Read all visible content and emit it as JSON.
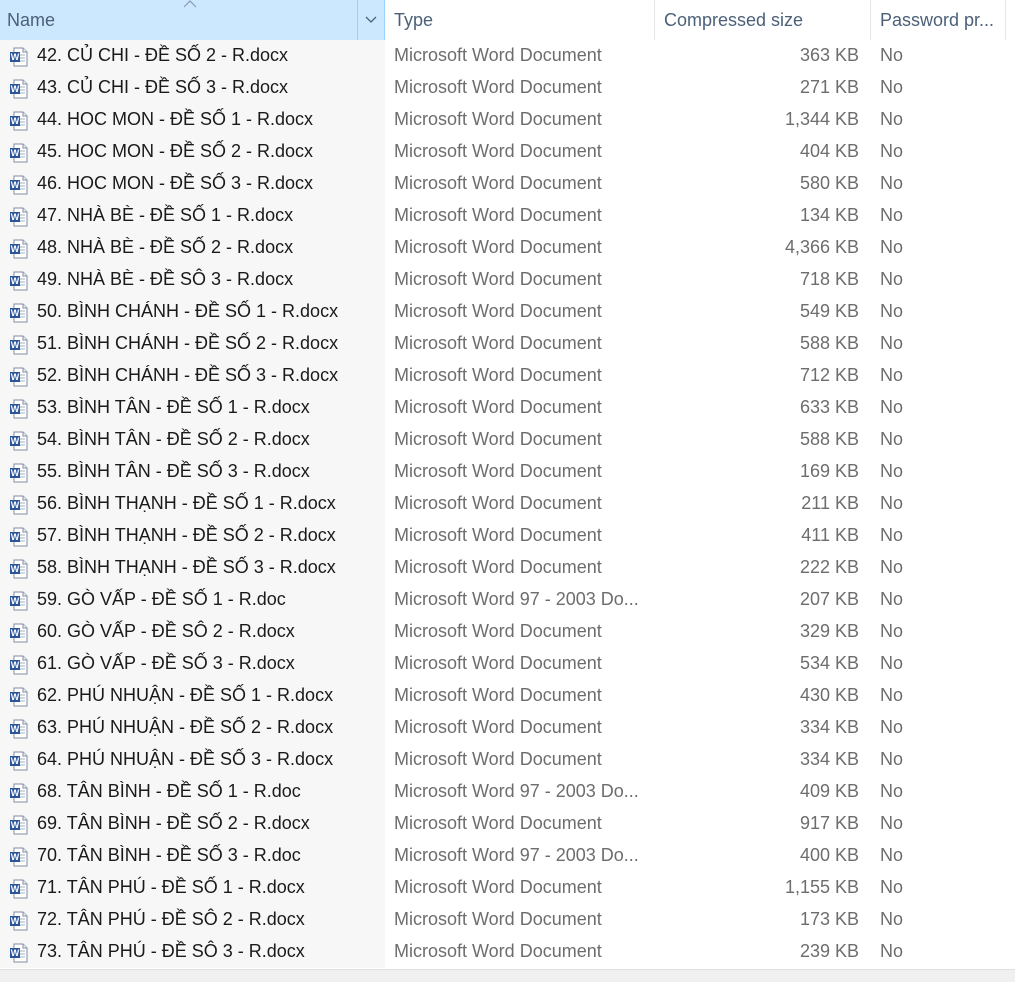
{
  "header": {
    "name_label": "Name",
    "type_label": "Type",
    "size_label": "Compressed size",
    "password_label": "Password pr..."
  },
  "colors": {
    "selected_header_bg": "#cce8ff",
    "header_text": "#4c607a",
    "word_icon_blue": "#2b579a"
  },
  "icons": {
    "file": "word-document-icon",
    "sort": "sort-up-arrow-icon",
    "dropdown": "chevron-down-icon"
  },
  "rows": [
    {
      "name": "42. CỦ CHI - ĐỀ SỐ 2 - R.docx",
      "type": "Microsoft Word Document",
      "size": "363 KB",
      "password": "No"
    },
    {
      "name": "43. CỦ CHI - ĐỀ SỐ 3 - R.docx",
      "type": "Microsoft Word Document",
      "size": "271 KB",
      "password": "No"
    },
    {
      "name": "44. HOC MON - ĐỀ SỐ 1 - R.docx",
      "type": "Microsoft Word Document",
      "size": "1,344 KB",
      "password": "No"
    },
    {
      "name": "45. HOC MON - ĐỀ SỐ 2 - R.docx",
      "type": "Microsoft Word Document",
      "size": "404 KB",
      "password": "No"
    },
    {
      "name": "46. HOC MON - ĐỀ SỐ 3 - R.docx",
      "type": "Microsoft Word Document",
      "size": "580 KB",
      "password": "No"
    },
    {
      "name": "47. NHÀ BÈ - ĐỀ SỐ 1 - R.docx",
      "type": "Microsoft Word Document",
      "size": "134 KB",
      "password": "No"
    },
    {
      "name": "48. NHÀ BÈ - ĐỀ SỐ 2 - R.docx",
      "type": "Microsoft Word Document",
      "size": "4,366 KB",
      "password": "No"
    },
    {
      "name": "49. NHÀ BÈ - ĐỀ SÔ 3 - R.docx",
      "type": "Microsoft Word Document",
      "size": "718 KB",
      "password": "No"
    },
    {
      "name": "50. BÌNH CHÁNH - ĐỀ SỐ 1 - R.docx",
      "type": "Microsoft Word Document",
      "size": "549 KB",
      "password": "No"
    },
    {
      "name": "51. BÌNH CHÁNH - ĐỀ SỐ 2 - R.docx",
      "type": "Microsoft Word Document",
      "size": "588 KB",
      "password": "No"
    },
    {
      "name": "52. BÌNH CHÁNH - ĐỀ SỐ 3 - R.docx",
      "type": "Microsoft Word Document",
      "size": "712 KB",
      "password": "No"
    },
    {
      "name": "53. BÌNH TÂN - ĐỀ SỐ 1 - R.docx",
      "type": "Microsoft Word Document",
      "size": "633 KB",
      "password": "No"
    },
    {
      "name": "54. BÌNH TÂN - ĐỀ SỐ 2 - R.docx",
      "type": "Microsoft Word Document",
      "size": "588 KB",
      "password": "No"
    },
    {
      "name": "55. BÌNH TÂN - ĐỀ SỐ 3 - R.docx",
      "type": "Microsoft Word Document",
      "size": "169 KB",
      "password": "No"
    },
    {
      "name": "56. BÌNH THẠNH - ĐỀ SỐ 1 - R.docx",
      "type": "Microsoft Word Document",
      "size": "211 KB",
      "password": "No"
    },
    {
      "name": "57. BÌNH THẠNH - ĐỀ SỐ 2 - R.docx",
      "type": "Microsoft Word Document",
      "size": "411 KB",
      "password": "No"
    },
    {
      "name": "58. BÌNH THẠNH - ĐỀ SỐ 3 - R.docx",
      "type": "Microsoft Word Document",
      "size": "222 KB",
      "password": "No"
    },
    {
      "name": "59. GÒ VẤP - ĐỀ SỐ 1 - R.doc",
      "type": "Microsoft Word 97 - 2003 Do...",
      "size": "207 KB",
      "password": "No"
    },
    {
      "name": "60. GÒ VẤP - ĐỀ SÔ 2 - R.docx",
      "type": "Microsoft Word Document",
      "size": "329 KB",
      "password": "No"
    },
    {
      "name": "61. GÒ VẤP - ĐỀ SỐ 3 - R.docx",
      "type": "Microsoft Word Document",
      "size": "534 KB",
      "password": "No"
    },
    {
      "name": "62. PHÚ NHUẬN - ĐỀ SỐ 1 - R.docx",
      "type": "Microsoft Word Document",
      "size": "430 KB",
      "password": "No"
    },
    {
      "name": "63. PHÚ NHUẬN - ĐỀ SỐ 2 - R.docx",
      "type": "Microsoft Word Document",
      "size": "334 KB",
      "password": "No"
    },
    {
      "name": "64. PHÚ NHUẬN - ĐỀ SỐ 3 - R.docx",
      "type": "Microsoft Word Document",
      "size": "334 KB",
      "password": "No"
    },
    {
      "name": "68. TÂN BÌNH - ĐỀ SỐ 1 - R.doc",
      "type": "Microsoft Word 97 - 2003 Do...",
      "size": "409 KB",
      "password": "No"
    },
    {
      "name": "69. TÂN BÌNH - ĐỀ SỐ 2 - R.docx",
      "type": "Microsoft Word Document",
      "size": "917 KB",
      "password": "No"
    },
    {
      "name": "70. TÂN BÌNH - ĐỀ SỐ 3 - R.doc",
      "type": "Microsoft Word 97 - 2003 Do...",
      "size": "400 KB",
      "password": "No"
    },
    {
      "name": "71. TÂN PHÚ - ĐỀ SỐ 1 - R.docx",
      "type": "Microsoft Word Document",
      "size": "1,155 KB",
      "password": "No"
    },
    {
      "name": "72. TÂN PHÚ - ĐỀ SÔ 2 - R.docx",
      "type": "Microsoft Word Document",
      "size": "173 KB",
      "password": "No"
    },
    {
      "name": "73. TÂN PHÚ - ĐỀ SÔ 3 - R.docx",
      "type": "Microsoft Word Document",
      "size": "239 KB",
      "password": "No"
    }
  ]
}
